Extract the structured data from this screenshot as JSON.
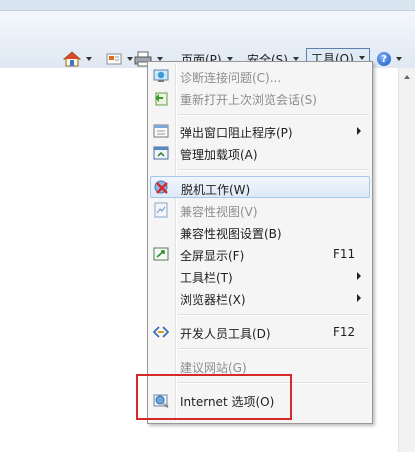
{
  "toolbar": {
    "page_label": "页面(P)",
    "safety_label": "安全(S)",
    "tools_label": "工具(O)",
    "icons": [
      "home-icon",
      "feeds-icon",
      "print-icon",
      "help-icon"
    ]
  },
  "menu": {
    "items": [
      {
        "label": "诊断连接问题(C)...",
        "shortcut": "",
        "enabled": false,
        "submenu": false,
        "icon": "diagnose-connection-icon"
      },
      {
        "label": "重新打开上次浏览会话(S)",
        "shortcut": "",
        "enabled": false,
        "submenu": false,
        "icon": "reopen-session-icon"
      },
      {
        "label": "弹出窗口阻止程序(P)",
        "shortcut": "",
        "enabled": true,
        "submenu": true,
        "icon": "popup-blocker-icon"
      },
      {
        "label": "管理加载项(A)",
        "shortcut": "",
        "enabled": true,
        "submenu": false,
        "icon": "manage-addons-icon"
      },
      {
        "label": "脱机工作(W)",
        "shortcut": "",
        "enabled": true,
        "submenu": false,
        "icon": "work-offline-icon"
      },
      {
        "label": "兼容性视图(V)",
        "shortcut": "",
        "enabled": false,
        "submenu": false,
        "icon": "compatibility-view-icon"
      },
      {
        "label": "兼容性视图设置(B)",
        "shortcut": "",
        "enabled": true,
        "submenu": false,
        "icon": ""
      },
      {
        "label": "全屏显示(F)",
        "shortcut": "F11",
        "enabled": true,
        "submenu": false,
        "icon": "fullscreen-icon"
      },
      {
        "label": "工具栏(T)",
        "shortcut": "",
        "enabled": true,
        "submenu": true,
        "icon": ""
      },
      {
        "label": "浏览器栏(X)",
        "shortcut": "",
        "enabled": true,
        "submenu": true,
        "icon": ""
      },
      {
        "label": "开发人员工具(D)",
        "shortcut": "F12",
        "enabled": true,
        "submenu": false,
        "icon": "developer-tools-icon"
      },
      {
        "label": "建议网站(G)",
        "shortcut": "",
        "enabled": false,
        "submenu": false,
        "icon": ""
      },
      {
        "label": "Internet 选项(O)",
        "shortcut": "",
        "enabled": true,
        "submenu": false,
        "icon": "internet-options-icon"
      }
    ]
  },
  "colors": {
    "highlight_box": "#d42a2a",
    "disabled_text": "#8d8d8d",
    "menu_bg": "#f5f5f5"
  }
}
